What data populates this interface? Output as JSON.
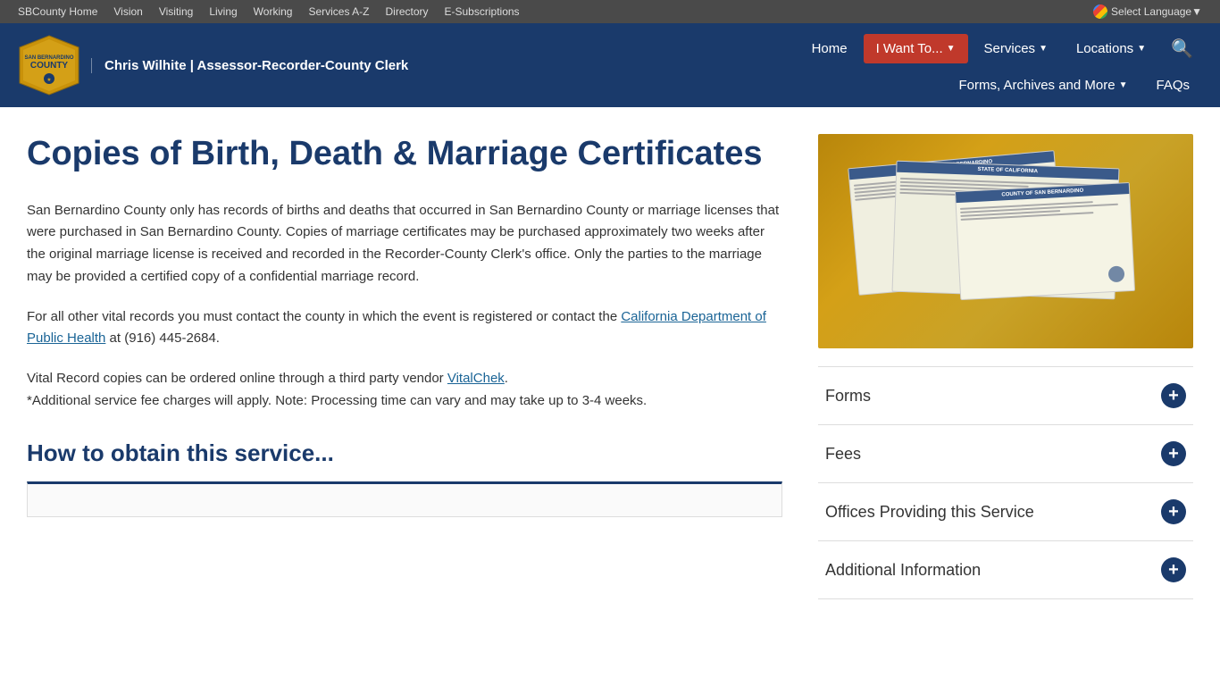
{
  "utility_bar": {
    "links": [
      {
        "label": "SBCounty Home",
        "href": "#"
      },
      {
        "label": "Vision",
        "href": "#"
      },
      {
        "label": "Visiting",
        "href": "#"
      },
      {
        "label": "Living",
        "href": "#"
      },
      {
        "label": "Working",
        "href": "#"
      },
      {
        "label": "Services A-Z",
        "href": "#"
      },
      {
        "label": "Directory",
        "href": "#"
      },
      {
        "label": "E-Subscriptions",
        "href": "#"
      }
    ],
    "translate_label": "Select Language"
  },
  "header": {
    "dept_name": "Chris Wilhite | Assessor-Recorder-County Clerk",
    "nav": {
      "row1": [
        {
          "label": "Home",
          "has_dropdown": false
        },
        {
          "label": "I Want To...",
          "has_dropdown": true
        },
        {
          "label": "Services",
          "has_dropdown": true
        },
        {
          "label": "Locations",
          "has_dropdown": true
        }
      ],
      "row2": [
        {
          "label": "Forms, Archives and More",
          "has_dropdown": true
        },
        {
          "label": "FAQs",
          "has_dropdown": false
        }
      ]
    }
  },
  "page": {
    "title": "Copies of Birth, Death & Marriage Certificates",
    "body_paragraph_1": "San Bernardino County only has records of births and deaths that occurred in San Bernardino County or marriage licenses that were purchased in San Bernardino County. Copies of marriage certificates may be purchased approximately two weeks after the original marriage license is received and recorded in the Recorder-County Clerk's office. Only the parties to the marriage may be provided a certified copy of a confidential marriage record.",
    "body_paragraph_2_prefix": "For all other vital records you must contact the county in which the event is registered or contact the ",
    "body_link_1": "California Department of Public Health",
    "body_paragraph_2_suffix": " at (916) 445-2684.",
    "body_paragraph_3_prefix": "Vital Record copies can be ordered online through a third party vendor ",
    "body_link_2": "VitalChek",
    "body_paragraph_3_suffix": ".",
    "body_paragraph_4": "*Additional service fee charges will apply. Note: Processing time can vary and may take up to 3-4 weeks.",
    "section_heading": "How to obtain this service..."
  },
  "sidebar": {
    "accordion": [
      {
        "id": "forms",
        "title": "Forms"
      },
      {
        "id": "fees",
        "title": "Fees"
      },
      {
        "id": "offices",
        "title": "Offices Providing this Service"
      },
      {
        "id": "additional",
        "title": "Additional Information"
      }
    ]
  }
}
